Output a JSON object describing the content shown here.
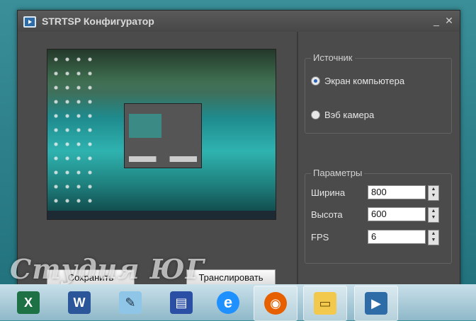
{
  "window": {
    "title": "STRTSP Конфигуратор",
    "minimize_glyph": "_",
    "close_glyph": "✕"
  },
  "buttons": {
    "save": "Сохранить",
    "stream": "Транслировать"
  },
  "source": {
    "title": "Источник",
    "options": [
      {
        "label": "Экран компьютера",
        "checked": true
      },
      {
        "label": "Вэб камера",
        "checked": false
      }
    ]
  },
  "params": {
    "title": "Параметры",
    "width": {
      "label": "Ширина",
      "value": "800"
    },
    "height": {
      "label": "Высота",
      "value": "600"
    },
    "fps": {
      "label": "FPS",
      "value": "6"
    }
  },
  "watermark": "Студия ЮГ",
  "taskbar": {
    "items": [
      {
        "icon": "excel-icon",
        "color": "#1e7145",
        "glyph": "X"
      },
      {
        "icon": "word-icon",
        "color": "#2b579a",
        "glyph": "W"
      },
      {
        "icon": "notepad-icon",
        "color": "#8fc6e8",
        "glyph": "✎"
      },
      {
        "icon": "server-icon",
        "color": "#2a4fa5",
        "glyph": "▤"
      },
      {
        "icon": "internet-explorer-icon",
        "color": "#1e90ff",
        "glyph": "e"
      },
      {
        "icon": "firefox-icon",
        "color": "#e66000",
        "glyph": "◉"
      },
      {
        "icon": "folder-icon",
        "color": "#f2c94c",
        "glyph": "▭"
      },
      {
        "icon": "strtsp-app-icon",
        "color": "#2e6ca8",
        "glyph": "▶"
      }
    ]
  }
}
